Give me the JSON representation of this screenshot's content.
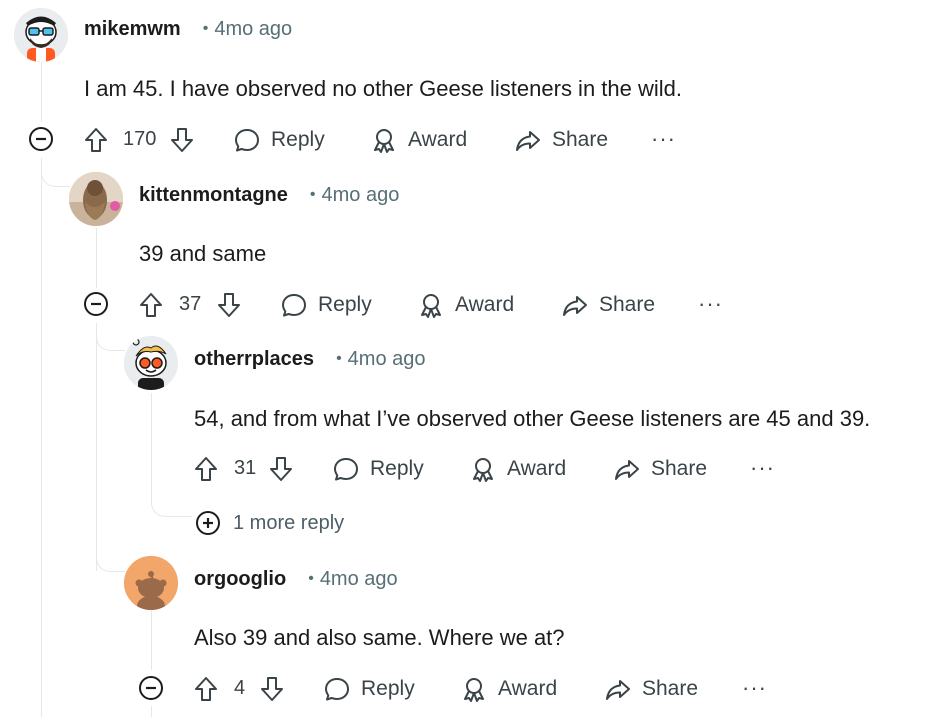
{
  "comments": [
    {
      "username": "mikemwm",
      "time": "4mo ago",
      "body": "I am 45. I have observed no other Geese listeners in the wild.",
      "votes": "170",
      "avatar": "snoo-glasses-beard-orange",
      "actions": {
        "reply": "Reply",
        "award": "Award",
        "share": "Share",
        "more": "···"
      }
    },
    {
      "username": "kittenmontagne",
      "time": "4mo ago",
      "body": "39 and same",
      "votes": "37",
      "avatar": "photo-furry-creature",
      "actions": {
        "reply": "Reply",
        "award": "Award",
        "share": "Share",
        "more": "···"
      }
    },
    {
      "username": "otherrplaces",
      "time": "4mo ago",
      "body": "54, and from what I’ve observed other Geese listeners are 45 and 39.",
      "votes": "31",
      "avatar": "snoo-orange-glasses",
      "actions": {
        "reply": "Reply",
        "award": "Award",
        "share": "Share",
        "more": "···"
      }
    },
    {
      "username": "orgooglio",
      "time": "4mo ago",
      "body": "Also 39 and also same. Where we at?",
      "votes": "4",
      "avatar": "default-snoo-orange",
      "actions": {
        "reply": "Reply",
        "award": "Award",
        "share": "Share",
        "more": "···"
      }
    }
  ],
  "more_replies": {
    "label": "1 more reply"
  },
  "colors": {
    "text": "#1c1c1c",
    "meta": "#576f76",
    "thread_line": "#e5e7ea",
    "action_text": "#3a4448",
    "default_avatar_bg": "#f2a66a"
  }
}
